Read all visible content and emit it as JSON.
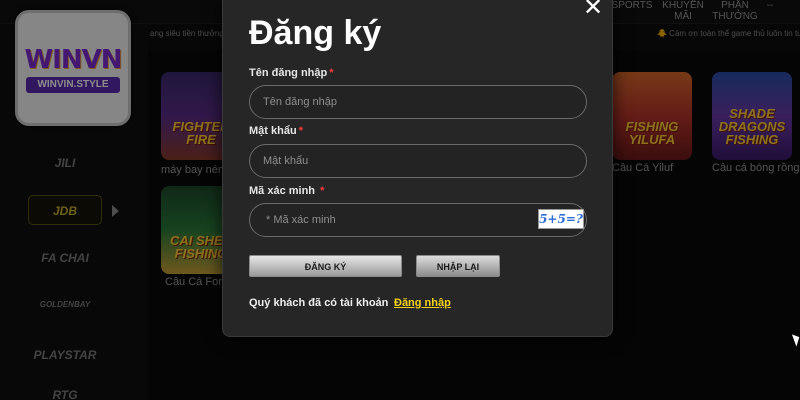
{
  "logo": {
    "main": "WINVN",
    "sub": "WINVIN.STYLE"
  },
  "topnav": {
    "sports": "SPORTS",
    "promo": "KHUYẾN MÃI",
    "reward": "PHẦN THƯỞNG",
    "more": "--"
  },
  "ticker": {
    "left": "ang siêu tiền thưởng tí ấn",
    "right": "🐥 Cảm ơn toàn thể game thủ luôn tin tư"
  },
  "providers": [
    "JILI",
    "JDB",
    "FA CHAI",
    "GOLDENBAY",
    "PLAYSTAR",
    "RTG"
  ],
  "games": [
    {
      "word": "FIGHTER FIRE",
      "caption": "máy bay ném",
      "color": "#5b2d8a"
    },
    {
      "word": "CAI SHEN FISHING",
      "caption": "Câu Cá Fon",
      "color": "#2a7b3a"
    },
    {
      "word": "FISHING YILUFA",
      "caption": "Câu Cá Yiluf",
      "color": "#b8342a"
    },
    {
      "word": "SHADE DRAGONS FISHING",
      "caption": "Câu cá bóng rồng",
      "color": "#6b3aa8"
    }
  ],
  "modal": {
    "title": "Đăng ký",
    "close": "✕",
    "username_label": "Tên đăng nhập",
    "username_placeholder": "Tên đăng nhập",
    "password_label": "Mật khẩu",
    "password_placeholder": "Mật khẩu",
    "captcha_label": "Mã xác minh",
    "captcha_placeholder": "* Mã xác minh",
    "captcha_image": "5+5=?",
    "required_mark": "*",
    "register_button": "ĐĂNG KÝ",
    "reset_button": "NHẬP LẠI",
    "account_text": "Quý khách đã có tài khoản",
    "login_link": "Đăng nhập"
  },
  "colors": {
    "accent": "#f4d21c",
    "required": "#ff3b3b",
    "modal_bg": "#262626"
  }
}
